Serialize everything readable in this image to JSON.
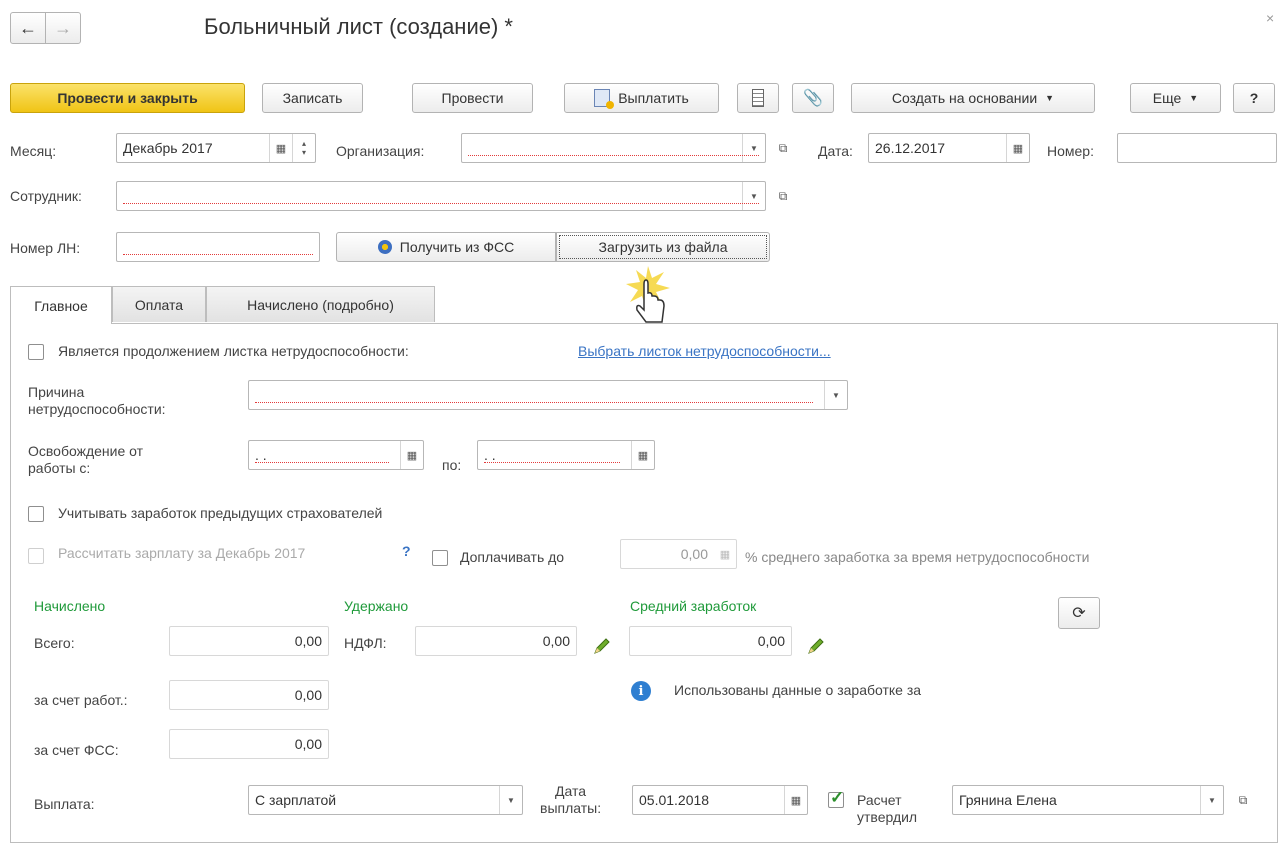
{
  "window": {
    "title": "Больничный лист (создание) *",
    "back_icon": "arrow-left-icon",
    "forward_icon": "arrow-right-icon"
  },
  "toolbar": {
    "post_and_close": "Провести и закрыть",
    "save": "Записать",
    "post": "Провести",
    "pay": "Выплатить",
    "create_based": "Создать на основании",
    "more": "Еще",
    "help": "?"
  },
  "header": {
    "month_label": "Месяц:",
    "month_value": "Декабрь 2017",
    "organization_label": "Организация:",
    "organization_value": "",
    "date_label": "Дата:",
    "date_value": "26.12.2017",
    "number_label": "Номер:",
    "number_value": "",
    "employee_label": "Сотрудник:",
    "employee_value": "",
    "ln_number_label": "Номер ЛН:",
    "ln_number_value": "",
    "get_from_fss": "Получить из ФСС",
    "load_from_file": "Загрузить из файла"
  },
  "tabs": [
    {
      "label": "Главное"
    },
    {
      "label": "Оплата"
    },
    {
      "label": "Начислено (подробно)"
    }
  ],
  "main": {
    "continuation_label": "Является продолжением листка нетрудоспособности:",
    "choose_sheet_link": "Выбрать листок нетрудоспособности...",
    "reason_label_1": "Причина",
    "reason_label_2": "нетрудоспособности:",
    "reason_value": "",
    "release_label_1": "Освобождение от",
    "release_label_2": "работы с:",
    "release_from_value": " .  .",
    "to_label": "по:",
    "release_to_value": " .  .",
    "consider_prev_label": "Учитывать заработок предыдущих страхователей",
    "calc_salary_label": "Рассчитать зарплату за Декабрь 2017",
    "calc_help": "?",
    "surcharge_label": "Доплачивать до",
    "surcharge_value": "0,00",
    "avg_earnings_text": "% среднего заработка за время нетрудоспособности"
  },
  "totals": {
    "accrued_header": "Начислено",
    "withheld_header": "Удержано",
    "avg_header": "Средний заработок",
    "total_label": "Всего:",
    "total_value": "0,00",
    "ndfl_label": "НДФЛ:",
    "ndfl_value": "0,00",
    "avg_value": "0,00",
    "employer_label": "за счет работ.:",
    "employer_value": "0,00",
    "fss_label": "за счет ФСС:",
    "fss_value": "0,00",
    "info_text": "Использованы данные о заработке за"
  },
  "payment": {
    "payment_label": "Выплата:",
    "payment_value": "С зарплатой",
    "pay_date_label_1": "Дата",
    "pay_date_label_2": "выплаты:",
    "pay_date_value": "05.01.2018",
    "approved_label_1": "Расчет",
    "approved_label_2": "утвердил",
    "approver_value": "Грянина Елена"
  },
  "colors": {
    "primary_button": "#f0c415",
    "section_header": "#1f9a3a",
    "link": "#3a74c4",
    "required_underline": "#e23b3b"
  }
}
